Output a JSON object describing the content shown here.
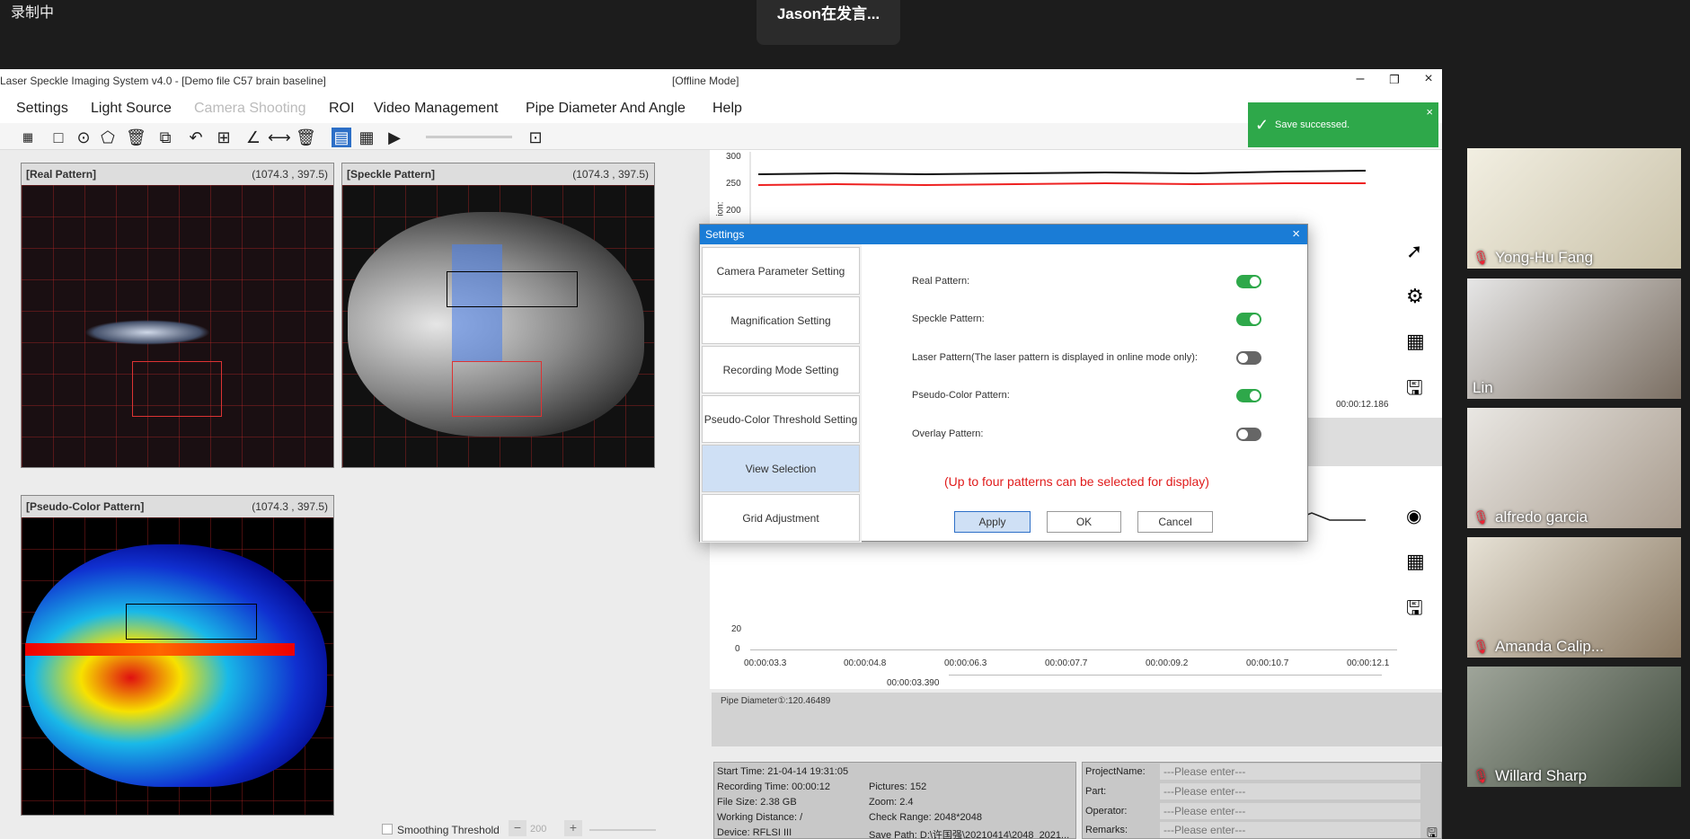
{
  "meeting": {
    "recording_label": "录制中",
    "speaker_label": "Jason在发言..."
  },
  "app": {
    "title": "Laser Speckle Imaging System v4.0 - [Demo file C57 brain baseline]",
    "mode": "[Offline Mode]",
    "menu": [
      "Settings",
      "Light Source",
      "Camera Shooting",
      "ROI",
      "Video Management",
      "Pipe Diameter And Angle",
      "Help"
    ],
    "toast": "Save successed."
  },
  "panels": {
    "real": {
      "name": "[Real Pattern]",
      "coord": "(1074.3 , 397.5)"
    },
    "speckle": {
      "name": "[Speckle Pattern]",
      "coord": "(1074.3 , 397.5)"
    },
    "pseudo": {
      "name": "[Pseudo-Color Pattern]",
      "coord": "(1074.3 , 397.5)"
    }
  },
  "top_chart": {
    "y_ticks": [
      "300",
      "250",
      "200"
    ],
    "y_label": "ion:",
    "end_time": "00:00:12.186"
  },
  "bottom_chart": {
    "y_ticks": [
      "20",
      "0"
    ],
    "x_ticks": [
      "00:00:03.3",
      "00:00:04.8",
      "00:00:06.3",
      "00:00:07.7",
      "00:00:09.2",
      "00:00:10.7",
      "00:00:12.1"
    ],
    "current_time": "00:00:03.390",
    "pipe_diameter": "Pipe Diameter①:120.46489"
  },
  "dialog": {
    "title": "Settings",
    "side_items": [
      "Camera Parameter Setting",
      "Magnification Setting",
      "Recording Mode Setting",
      "Pseudo-Color Threshold Setting",
      "View Selection",
      "Grid Adjustment"
    ],
    "options": [
      {
        "label": "Real Pattern:",
        "on": true
      },
      {
        "label": "Speckle Pattern:",
        "on": true
      },
      {
        "label": "Laser Pattern(The laser pattern is displayed in online mode only):",
        "on": false
      },
      {
        "label": "Pseudo-Color Pattern:",
        "on": true
      },
      {
        "label": "Overlay Pattern:",
        "on": false
      }
    ],
    "note": "(Up to four patterns can be selected for display)",
    "apply": "Apply",
    "ok": "OK",
    "cancel": "Cancel"
  },
  "bottom_bar": {
    "smoothing_label": "Smoothing Threshold",
    "smoothing_value": "200"
  },
  "info": {
    "start_time": "Start Time: 21-04-14 19:31:05",
    "recording_time": "Recording Time: 00:00:12",
    "file_size": "File Size: 2.38 GB",
    "working_distance": "Working Distance:  /",
    "device": "Device: RFLSI III",
    "pictures": "Pictures: 152",
    "zoom": "Zoom: 2.4",
    "check_range": "Check Range: 2048*2048",
    "save_path": "Save Path:   D:\\许国强\\20210414\\2048_2021..."
  },
  "project": {
    "fields": [
      {
        "label": "ProjectName:",
        "placeholder": "---Please enter---"
      },
      {
        "label": "Part:",
        "placeholder": "---Please enter---"
      },
      {
        "label": "Operator:",
        "placeholder": "---Please enter---"
      },
      {
        "label": "Remarks:",
        "placeholder": "---Please enter---"
      }
    ]
  },
  "participants": [
    {
      "name": "Yong-Hu Fang",
      "muted": true
    },
    {
      "name": "Lin",
      "muted": false
    },
    {
      "name": "alfredo garcia",
      "muted": true
    },
    {
      "name": "Amanda Calip...",
      "muted": true
    },
    {
      "name": "Willard Sharp",
      "muted": true
    }
  ]
}
